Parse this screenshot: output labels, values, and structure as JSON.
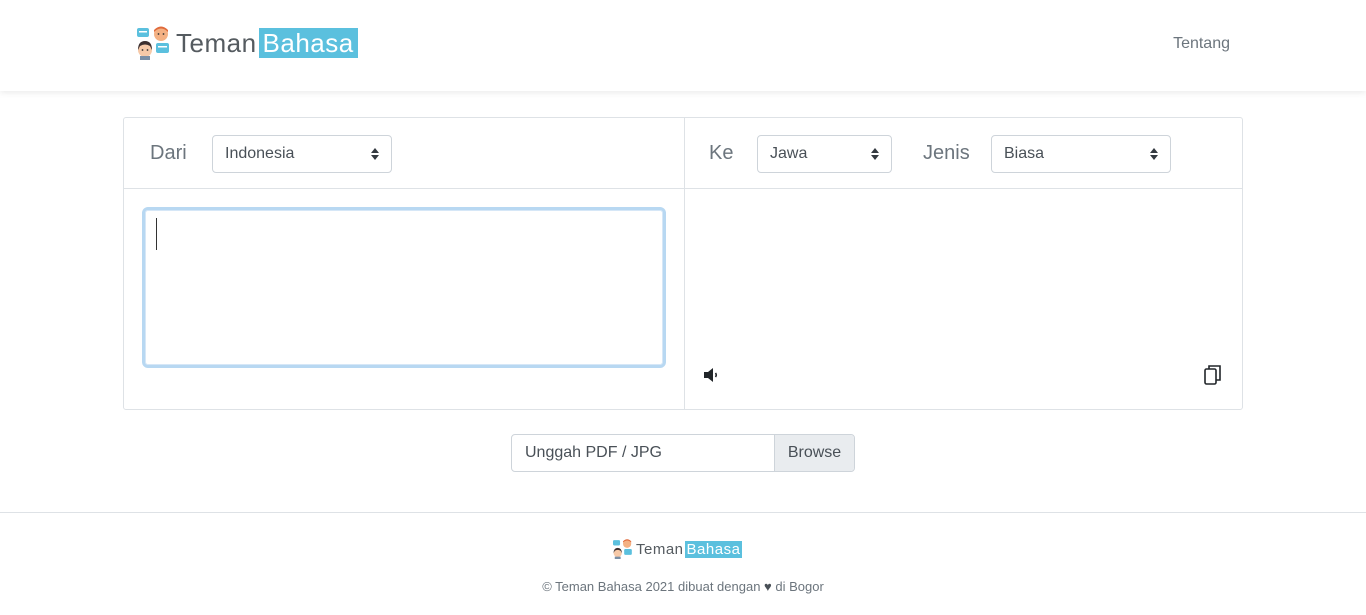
{
  "header": {
    "brand_part1": "Teman",
    "brand_part2": "Bahasa",
    "nav_about": "Tentang"
  },
  "translator": {
    "from_label": "Dari",
    "from_value": "Indonesia",
    "to_label": "Ke",
    "to_value": "Jawa",
    "type_label": "Jenis",
    "type_value": "Biasa",
    "input_text": "",
    "output_text": ""
  },
  "upload": {
    "placeholder": "Unggah PDF / JPG",
    "browse_label": "Browse"
  },
  "footer": {
    "brand_part1": "Teman",
    "brand_part2": "Bahasa",
    "copyright_prefix": "© Teman Bahasa 2021 dibuat dengan",
    "heart_symbol": "♥",
    "copyright_suffix": "di Bogor"
  },
  "colors": {
    "brand_accent": "#5bc0de",
    "border": "#dee2e6",
    "focus": "#b8d8f2"
  }
}
